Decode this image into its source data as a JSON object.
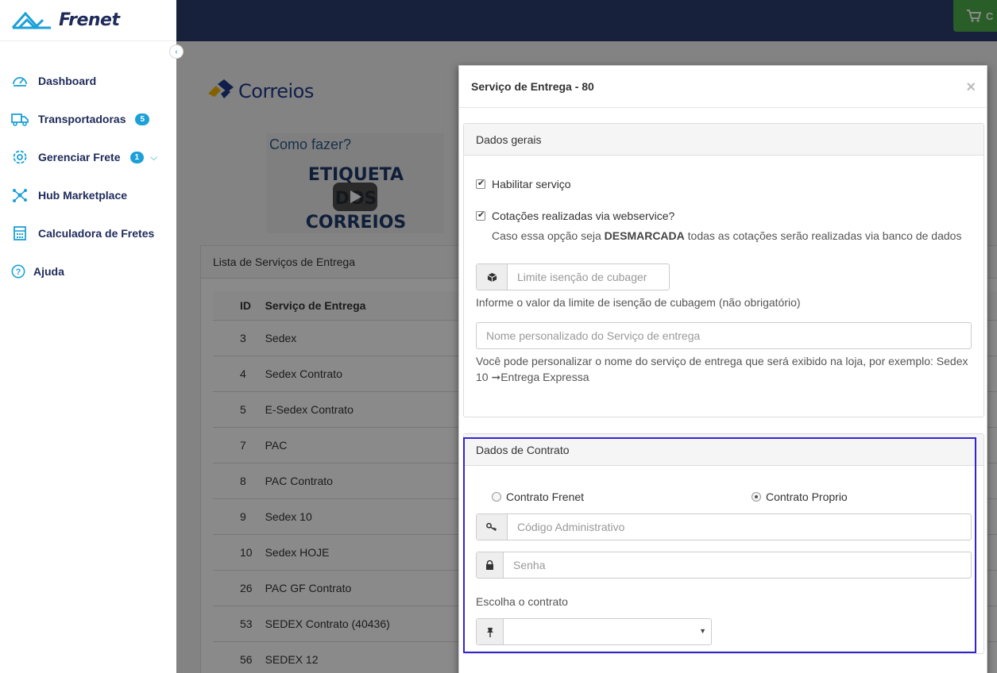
{
  "app": {
    "brand": "Frenet"
  },
  "sidebar": {
    "items": [
      {
        "label": "Dashboard",
        "icon": "speedometer-icon"
      },
      {
        "label": "Transportadoras",
        "icon": "truck-icon",
        "badge": "5"
      },
      {
        "label": "Gerenciar Frete",
        "icon": "gear-icon",
        "badge": "1"
      },
      {
        "label": "Hub Marketplace",
        "icon": "hub-icon"
      },
      {
        "label": "Calculadora de Fretes",
        "icon": "calculator-icon"
      },
      {
        "label": "Ajuda",
        "icon": "help-icon"
      }
    ]
  },
  "topbar": {
    "cart_label": "C"
  },
  "page": {
    "carrier_name": "Correios",
    "video_title": "Como fazer?",
    "video_line1": "ETIQUETA DOS",
    "video_line2": "CORREIOS",
    "list_title": "Lista de Serviços de Entrega",
    "table": {
      "headers": [
        "ID",
        "Serviço de Entrega"
      ],
      "rows": [
        [
          "3",
          "Sedex"
        ],
        [
          "4",
          "Sedex Contrato"
        ],
        [
          "5",
          "E-Sedex Contrato"
        ],
        [
          "7",
          "PAC"
        ],
        [
          "8",
          "PAC Contrato"
        ],
        [
          "9",
          "Sedex 10"
        ],
        [
          "10",
          "Sedex HOJE"
        ],
        [
          "26",
          "PAC GF Contrato"
        ],
        [
          "53",
          "SEDEX Contrato (40436)"
        ],
        [
          "56",
          "SEDEX 12"
        ]
      ]
    }
  },
  "modal": {
    "title": "Serviço de Entrega - 80",
    "close": "×",
    "general": {
      "heading": "Dados gerais",
      "enable_label": "Habilitar serviço",
      "enable_checked": true,
      "webservice_label": "Cotações realizadas via webservice?",
      "webservice_checked": true,
      "webservice_help_prefix": "Caso essa opção seja",
      "webservice_help_bold": "DESMARCADA",
      "webservice_help_suffix": "todas as cotações serão realizadas via banco de dados",
      "cubage_placeholder": "Limite isenção de cubager",
      "cubage_help": "Informe o valor da limite de isenção de cubagem (não obrigatório)",
      "name_placeholder": "Nome personalizado do Serviço de entrega",
      "name_help": "Você pode personalizar o nome do serviço de entrega que será exibido na loja, por exemplo: Sedex 10 ➞Entrega Expressa"
    },
    "contract": {
      "heading": "Dados de Contrato",
      "option_frenet": "Contrato Frenet",
      "option_own": "Contrato Proprio",
      "selected": "Contrato Proprio",
      "code_placeholder": "Código Administrativo",
      "password_placeholder": "Senha",
      "choose_label": "Escolha o contrato",
      "choose_value": ""
    }
  },
  "colors": {
    "brand_navy": "#1e2a5a",
    "accent_blue": "#1ca0d8",
    "topbar": "#2c3e70",
    "cart_green": "#4cae4c",
    "highlight": "#3323d6"
  }
}
